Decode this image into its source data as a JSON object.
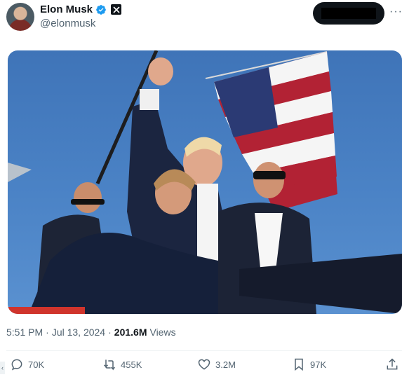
{
  "author": {
    "name": "Elon Musk",
    "handle": "@elonmusk",
    "verified_icon": "verified-badge-icon",
    "affiliation_icon": "x-logo-icon"
  },
  "menu": {
    "more_label": "···"
  },
  "post": {
    "time": "5:51 PM",
    "separator1": "·",
    "date": "Jul 13, 2024",
    "separator2": "·",
    "views_count": "201.6M",
    "views_label": "Views"
  },
  "actions": {
    "replies": "70K",
    "reposts": "455K",
    "likes": "3.2M",
    "bookmarks": "97K"
  },
  "colors": {
    "text_primary": "#0f1419",
    "text_secondary": "#536471",
    "verified_blue": "#1d9bf0",
    "sky": "#4b83c6"
  }
}
